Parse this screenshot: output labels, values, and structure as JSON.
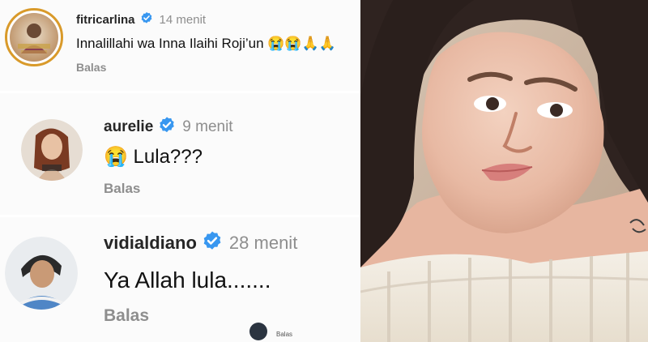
{
  "comments": [
    {
      "handle": "fitricarlina",
      "time": "14 menit",
      "text": "Innalillahi wa Inna Ilaihi Roji’un 😭😭🙏🙏",
      "reply": "Balas",
      "verified": true
    },
    {
      "handle": "aurelie",
      "time": "9 menit",
      "text": "😭 Lula???",
      "reply": "Balas",
      "verified": true
    },
    {
      "handle": "vidialdiano",
      "time": "28 menit",
      "text": "Ya Allah lula.......",
      "reply": "Balas",
      "verified": true
    }
  ],
  "footer": {
    "reply": "Balas"
  },
  "icons": {
    "verified": "verified-badge-icon",
    "verified_color": "#3897f0"
  }
}
